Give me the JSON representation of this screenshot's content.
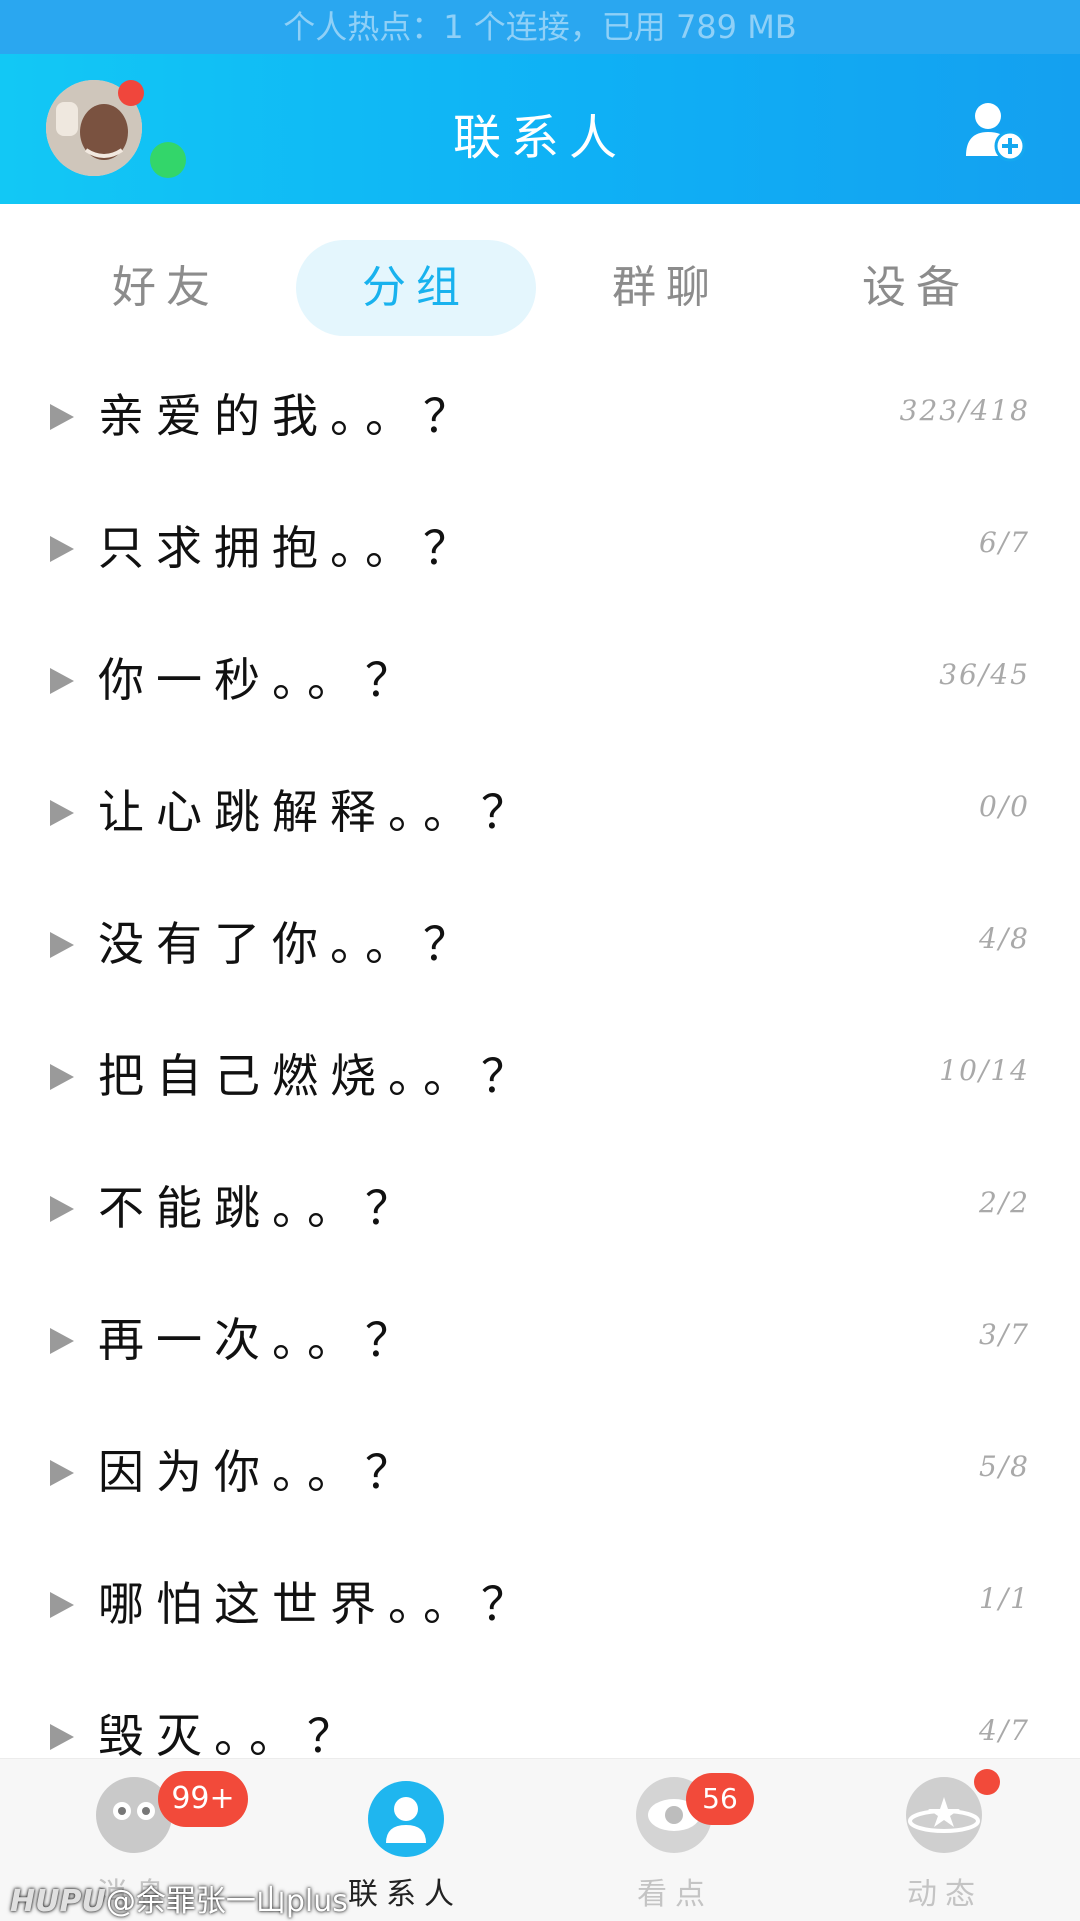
{
  "status_bar": {
    "text": "个人热点：1 个连接，已用 789 MB"
  },
  "header": {
    "title": "联系人"
  },
  "tabs": [
    {
      "label": "好友"
    },
    {
      "label": "分组",
      "active": true
    },
    {
      "label": "群聊"
    },
    {
      "label": "设备"
    }
  ],
  "groups": [
    {
      "name": "亲爱的我。。？",
      "count": "323/418"
    },
    {
      "name": "只求拥抱。。？",
      "count": "6/7"
    },
    {
      "name": "你一秒。。？",
      "count": "36/45"
    },
    {
      "name": "让心跳解释。。？",
      "count": "0/0"
    },
    {
      "name": "没有了你。。？",
      "count": "4/8"
    },
    {
      "name": "把自己燃烧。。？",
      "count": "10/14"
    },
    {
      "name": "不能跳。。？",
      "count": "2/2"
    },
    {
      "name": "再一次。。？",
      "count": "3/7"
    },
    {
      "name": "因为你。。？",
      "count": "5/8"
    },
    {
      "name": "哪怕这世界。。？",
      "count": "1/1"
    },
    {
      "name": "毁灭。。？",
      "count": "4/7"
    }
  ],
  "bottom_nav": {
    "messages": {
      "label": "消息",
      "badge": "99+",
      "icon": "chat-bubble-icon"
    },
    "contacts": {
      "label": "联系人",
      "icon": "person-icon"
    },
    "watch": {
      "label": "看点",
      "badge": "56",
      "icon": "eye-icon"
    },
    "feed": {
      "label": "动态",
      "icon": "planet-star-icon"
    }
  },
  "watermark": {
    "brand": "HUPU",
    "text": "@余罪张一山plus"
  },
  "colors": {
    "accent": "#18b2ee",
    "header": "#0fb0f5",
    "badge": "#f24a3a",
    "online": "#33d66a"
  }
}
